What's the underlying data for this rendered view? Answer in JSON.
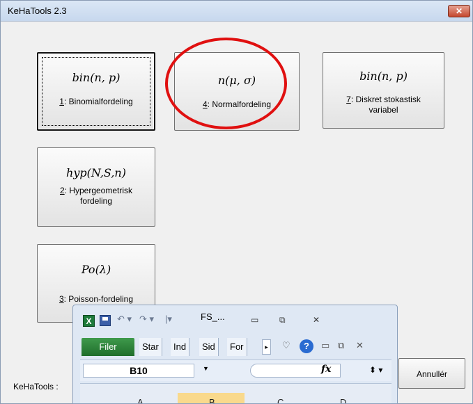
{
  "dialog": {
    "title": "KeHaTools 2.3",
    "close_label": "✕",
    "footer_text": "KeHaTools :",
    "cancel_label": "Annullér",
    "buttons": [
      {
        "formula": "bin(n, p)",
        "key": "1",
        "label": ": Binomialfordeling"
      },
      {
        "formula": "n(μ, σ)",
        "key": "4",
        "label": ": Normalfordeling"
      },
      {
        "formula": "bin(n, p)",
        "key": "7",
        "label_line1": ": Diskret stokastisk",
        "label_line2": "variabel"
      },
      {
        "formula": "hyp(N,S,n)",
        "key": "2",
        "label_line1": ": Hypergeometrisk",
        "label_line2": "fordeling"
      },
      {
        "formula": "Po(λ)",
        "key": "3",
        "label": ": Poisson-fordeling"
      }
    ]
  },
  "excel": {
    "filename": "FS_...",
    "tabs": {
      "file": "Filer",
      "t1": "Star",
      "t2": "Ind",
      "t3": "Sid",
      "t4": "For"
    },
    "name_box": "B10",
    "fx": "fx",
    "columns": [
      "A",
      "B",
      "C",
      "D"
    ]
  }
}
